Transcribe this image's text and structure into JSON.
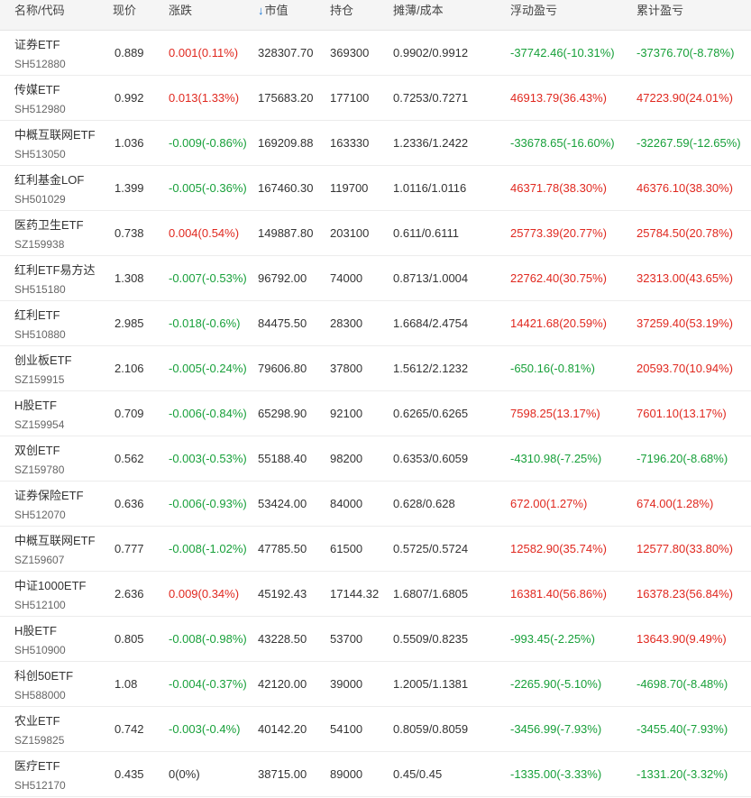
{
  "colors": {
    "up": "#e0281f",
    "down": "#18a03a",
    "flat": "#333333",
    "sort_icon": "#1677d6"
  },
  "header": {
    "name_code": "名称/代码",
    "price": "现价",
    "change": "涨跌",
    "sort_icon": "↓",
    "market_value": "市值",
    "position": "持仓",
    "cost": "摊薄/成本",
    "float_pnl": "浮动盈亏",
    "total_pnl": "累计盈亏"
  },
  "rows": [
    {
      "name": "证券ETF",
      "code": "SH512880",
      "price": "0.889",
      "change": "0.001(0.11%)",
      "change_dir": "up",
      "market_value": "328307.70",
      "position": "369300",
      "cost": "0.9902/0.9912",
      "float_pnl": "-37742.46(-10.31%)",
      "float_dir": "down",
      "total_pnl": "-37376.70(-8.78%)",
      "total_dir": "down"
    },
    {
      "name": "传媒ETF",
      "code": "SH512980",
      "price": "0.992",
      "change": "0.013(1.33%)",
      "change_dir": "up",
      "market_value": "175683.20",
      "position": "177100",
      "cost": "0.7253/0.7271",
      "float_pnl": "46913.79(36.43%)",
      "float_dir": "up",
      "total_pnl": "47223.90(24.01%)",
      "total_dir": "up"
    },
    {
      "name": "中概互联网ETF",
      "code": "SH513050",
      "price": "1.036",
      "change": "-0.009(-0.86%)",
      "change_dir": "down",
      "market_value": "169209.88",
      "position": "163330",
      "cost": "1.2336/1.2422",
      "float_pnl": "-33678.65(-16.60%)",
      "float_dir": "down",
      "total_pnl": "-32267.59(-12.65%)",
      "total_dir": "down"
    },
    {
      "name": "红利基金LOF",
      "code": "SH501029",
      "price": "1.399",
      "change": "-0.005(-0.36%)",
      "change_dir": "down",
      "market_value": "167460.30",
      "position": "119700",
      "cost": "1.0116/1.0116",
      "float_pnl": "46371.78(38.30%)",
      "float_dir": "up",
      "total_pnl": "46376.10(38.30%)",
      "total_dir": "up"
    },
    {
      "name": "医药卫生ETF",
      "code": "SZ159938",
      "price": "0.738",
      "change": "0.004(0.54%)",
      "change_dir": "up",
      "market_value": "149887.80",
      "position": "203100",
      "cost": "0.611/0.6111",
      "float_pnl": "25773.39(20.77%)",
      "float_dir": "up",
      "total_pnl": "25784.50(20.78%)",
      "total_dir": "up"
    },
    {
      "name": "红利ETF易方达",
      "code": "SH515180",
      "price": "1.308",
      "change": "-0.007(-0.53%)",
      "change_dir": "down",
      "market_value": "96792.00",
      "position": "74000",
      "cost": "0.8713/1.0004",
      "float_pnl": "22762.40(30.75%)",
      "float_dir": "up",
      "total_pnl": "32313.00(43.65%)",
      "total_dir": "up"
    },
    {
      "name": "红利ETF",
      "code": "SH510880",
      "price": "2.985",
      "change": "-0.018(-0.6%)",
      "change_dir": "down",
      "market_value": "84475.50",
      "position": "28300",
      "cost": "1.6684/2.4754",
      "float_pnl": "14421.68(20.59%)",
      "float_dir": "up",
      "total_pnl": "37259.40(53.19%)",
      "total_dir": "up"
    },
    {
      "name": "创业板ETF",
      "code": "SZ159915",
      "price": "2.106",
      "change": "-0.005(-0.24%)",
      "change_dir": "down",
      "market_value": "79606.80",
      "position": "37800",
      "cost": "1.5612/2.1232",
      "float_pnl": "-650.16(-0.81%)",
      "float_dir": "down",
      "total_pnl": "20593.70(10.94%)",
      "total_dir": "up"
    },
    {
      "name": "H股ETF",
      "code": "SZ159954",
      "price": "0.709",
      "change": "-0.006(-0.84%)",
      "change_dir": "down",
      "market_value": "65298.90",
      "position": "92100",
      "cost": "0.6265/0.6265",
      "float_pnl": "7598.25(13.17%)",
      "float_dir": "up",
      "total_pnl": "7601.10(13.17%)",
      "total_dir": "up"
    },
    {
      "name": "双创ETF",
      "code": "SZ159780",
      "price": "0.562",
      "change": "-0.003(-0.53%)",
      "change_dir": "down",
      "market_value": "55188.40",
      "position": "98200",
      "cost": "0.6353/0.6059",
      "float_pnl": "-4310.98(-7.25%)",
      "float_dir": "down",
      "total_pnl": "-7196.20(-8.68%)",
      "total_dir": "down"
    },
    {
      "name": "证券保险ETF",
      "code": "SH512070",
      "price": "0.636",
      "change": "-0.006(-0.93%)",
      "change_dir": "down",
      "market_value": "53424.00",
      "position": "84000",
      "cost": "0.628/0.628",
      "float_pnl": "672.00(1.27%)",
      "float_dir": "up",
      "total_pnl": "674.00(1.28%)",
      "total_dir": "up"
    },
    {
      "name": "中概互联网ETF",
      "code": "SZ159607",
      "price": "0.777",
      "change": "-0.008(-1.02%)",
      "change_dir": "down",
      "market_value": "47785.50",
      "position": "61500",
      "cost": "0.5725/0.5724",
      "float_pnl": "12582.90(35.74%)",
      "float_dir": "up",
      "total_pnl": "12577.80(33.80%)",
      "total_dir": "up"
    },
    {
      "name": "中证1000ETF",
      "code": "SH512100",
      "price": "2.636",
      "change": "0.009(0.34%)",
      "change_dir": "up",
      "market_value": "45192.43",
      "position": "17144.32",
      "cost": "1.6807/1.6805",
      "float_pnl": "16381.40(56.86%)",
      "float_dir": "up",
      "total_pnl": "16378.23(56.84%)",
      "total_dir": "up"
    },
    {
      "name": "H股ETF",
      "code": "SH510900",
      "price": "0.805",
      "change": "-0.008(-0.98%)",
      "change_dir": "down",
      "market_value": "43228.50",
      "position": "53700",
      "cost": "0.5509/0.8235",
      "float_pnl": "-993.45(-2.25%)",
      "float_dir": "down",
      "total_pnl": "13643.90(9.49%)",
      "total_dir": "up"
    },
    {
      "name": "科创50ETF",
      "code": "SH588000",
      "price": "1.08",
      "change": "-0.004(-0.37%)",
      "change_dir": "down",
      "market_value": "42120.00",
      "position": "39000",
      "cost": "1.2005/1.1381",
      "float_pnl": "-2265.90(-5.10%)",
      "float_dir": "down",
      "total_pnl": "-4698.70(-8.48%)",
      "total_dir": "down"
    },
    {
      "name": "农业ETF",
      "code": "SZ159825",
      "price": "0.742",
      "change": "-0.003(-0.4%)",
      "change_dir": "down",
      "market_value": "40142.20",
      "position": "54100",
      "cost": "0.8059/0.8059",
      "float_pnl": "-3456.99(-7.93%)",
      "float_dir": "down",
      "total_pnl": "-3455.40(-7.93%)",
      "total_dir": "down"
    },
    {
      "name": "医疗ETF",
      "code": "SH512170",
      "price": "0.435",
      "change": "0(0%)",
      "change_dir": "flat",
      "market_value": "38715.00",
      "position": "89000",
      "cost": "0.45/0.45",
      "float_pnl": "-1335.00(-3.33%)",
      "float_dir": "down",
      "total_pnl": "-1331.20(-3.32%)",
      "total_dir": "down"
    }
  ]
}
